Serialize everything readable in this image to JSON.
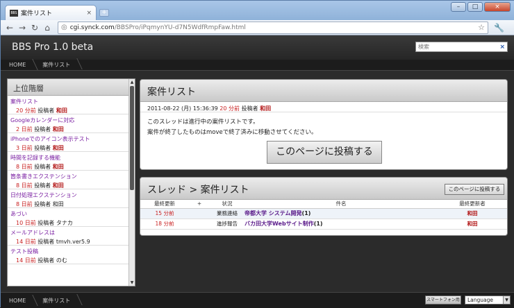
{
  "browser": {
    "tab_favicon": "BBS",
    "tab_title": "案件リスト",
    "tab_close": "×",
    "new_tab": "+",
    "url_host": "cgi.synck.com",
    "url_path": "/BBSPro/iPqmynYU-d7N5WdfRmpFaw.html",
    "win_min": "–",
    "win_max": "□",
    "win_close": "×"
  },
  "header": {
    "brand": "BBS Pro 1.0 beta",
    "search_placeholder": "検索",
    "search_clear": "×"
  },
  "breadcrumb": [
    "HOME",
    "案件リスト"
  ],
  "sidebar": {
    "title": "上位階層",
    "items": [
      {
        "title": "案件リスト",
        "time": "20 分前",
        "label": "投稿者",
        "author": "和田",
        "author_plain": false
      },
      {
        "title": "Googleカレンダーに対応",
        "time": "2 日前",
        "label": "投稿者",
        "author": "和田",
        "author_plain": false
      },
      {
        "title": "iPhoneでのアイコン表示テスト",
        "time": "3 日前",
        "label": "投稿者",
        "author": "和田",
        "author_plain": false
      },
      {
        "title": "時間を記録する機能",
        "time": "8 日前",
        "label": "投稿者",
        "author": "和田",
        "author_plain": false
      },
      {
        "title": "箇条書きエクステンション",
        "time": "8 日前",
        "label": "投稿者",
        "author": "和田",
        "author_plain": false
      },
      {
        "title": "日付処理エクステンション",
        "time": "8 日前",
        "label": "投稿者",
        "author": "和田",
        "author_plain": true
      },
      {
        "title": "あづい",
        "time": "10 日前",
        "label": "投稿者",
        "author": "タナカ",
        "author_plain": true
      },
      {
        "title": "メールアドレスは",
        "time": "14 日前",
        "label": "投稿者",
        "author": "tmvh.ver5.9",
        "author_plain": true
      },
      {
        "title": "テスト投稿",
        "time": "14 日前",
        "label": "投稿者",
        "author": "のむ",
        "author_plain": true
      }
    ]
  },
  "post": {
    "title": "案件リスト",
    "date": "2011-08-22 (月) 15:36:39",
    "time": "20 分前",
    "label": "投稿者",
    "author": "和田",
    "body1": "このスレッドは進行中の案件リストです。",
    "body2": "案件が終了したものはmoveで終了済みに移動させてください。",
    "post_button": "このページに投稿する"
  },
  "thread": {
    "title": "スレッド > 案件リスト",
    "post_button": "このページに投稿する",
    "columns": [
      "最終更新",
      "+",
      "状況",
      "件名",
      "最終更新者"
    ],
    "rows": [
      {
        "time": "15 分前",
        "status": "業務連絡",
        "subject": "帝都大学 システム開発",
        "count": "(1)",
        "author": "和田"
      },
      {
        "time": "18 分前",
        "status": "進捗報告",
        "subject": "バカ田大学Webサイト制作",
        "count": "(1)",
        "author": "和田"
      }
    ]
  },
  "footer": {
    "breadcrumb": [
      "HOME",
      "案件リスト"
    ],
    "smartphone_button": "スマートフォン用",
    "language": "Language"
  }
}
